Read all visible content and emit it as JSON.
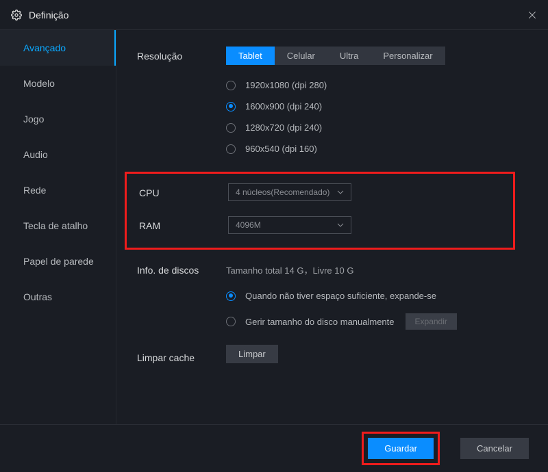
{
  "titlebar": {
    "title": "Definição"
  },
  "sidebar": {
    "items": [
      {
        "label": "Avançado"
      },
      {
        "label": "Modelo"
      },
      {
        "label": "Jogo"
      },
      {
        "label": "Audio"
      },
      {
        "label": "Rede"
      },
      {
        "label": "Tecla de atalho"
      },
      {
        "label": "Papel de parede"
      },
      {
        "label": "Outras"
      }
    ]
  },
  "resolution": {
    "label": "Resolução",
    "tabs": [
      {
        "label": "Tablet"
      },
      {
        "label": "Celular"
      },
      {
        "label": "Ultra"
      },
      {
        "label": "Personalizar"
      }
    ],
    "options": [
      {
        "label": "1920x1080  (dpi 280)"
      },
      {
        "label": "1600x900  (dpi 240)"
      },
      {
        "label": "1280x720  (dpi 240)"
      },
      {
        "label": "960x540  (dpi 160)"
      }
    ]
  },
  "cpu": {
    "label": "CPU",
    "value": "4 núcleos(Recomendado)"
  },
  "ram": {
    "label": "RAM",
    "value": "4096M"
  },
  "disk": {
    "label": "Info. de discos",
    "summary": "Tamanho total 14 G，Livre 10 G",
    "options": [
      {
        "label": "Quando não tiver espaço suficiente, expande-se"
      },
      {
        "label": "Gerir tamanho do disco manualmente"
      }
    ],
    "expand_btn": "Expandir"
  },
  "cache": {
    "label": "Limpar cache",
    "button": "Limpar"
  },
  "footer": {
    "save": "Guardar",
    "cancel": "Cancelar"
  }
}
